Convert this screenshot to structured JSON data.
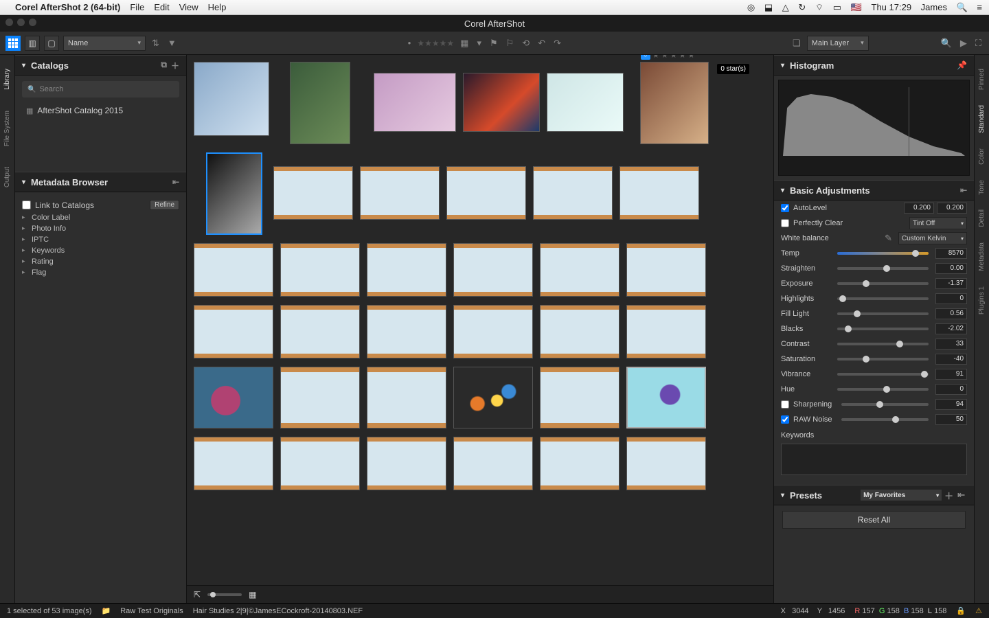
{
  "macbar": {
    "app": "Corel AfterShot 2 (64-bit)",
    "menus": [
      "File",
      "Edit",
      "View",
      "Help"
    ],
    "right": {
      "clock": "Thu 17:29",
      "user": "James"
    }
  },
  "titlebar": {
    "title": "Corel AfterShot"
  },
  "toolbar": {
    "sort_label": "Name",
    "layer_label": "Main Layer"
  },
  "rating_tooltip": "0 star(s)",
  "left_tabs": [
    "Library",
    "File System",
    "Output"
  ],
  "right_tabs": [
    "Pinned",
    "Standard",
    "Color",
    "Tone",
    "Detail",
    "Metadata",
    "Plugins 1"
  ],
  "catalogs": {
    "title": "Catalogs",
    "search_placeholder": "Search",
    "items": [
      "AfterShot Catalog 2015"
    ]
  },
  "metadata_browser": {
    "title": "Metadata Browser",
    "link_label": "Link to Catalogs",
    "refine_label": "Refine",
    "tree": [
      "Color Label",
      "Photo Info",
      "IPTC",
      "Keywords",
      "Rating",
      "Flag"
    ]
  },
  "histogram": {
    "title": "Histogram"
  },
  "basic_adjustments": {
    "title": "Basic Adjustments",
    "autolevel": {
      "label": "AutoLevel",
      "checked": true,
      "v1": "0.200",
      "v2": "0.200"
    },
    "perfectly_clear": {
      "label": "Perfectly Clear",
      "checked": false,
      "dropdown": "Tint Off"
    },
    "white_balance": {
      "label": "White balance",
      "dropdown": "Custom Kelvin"
    },
    "sliders": {
      "temp": {
        "label": "Temp",
        "value": "8570",
        "pos": 82
      },
      "straighten": {
        "label": "Straighten",
        "value": "0.00",
        "pos": 50
      },
      "exposure": {
        "label": "Exposure",
        "value": "-1.37",
        "pos": 28
      },
      "highlights": {
        "label": "Highlights",
        "value": "0",
        "pos": 2
      },
      "fill_light": {
        "label": "Fill Light",
        "value": "0.56",
        "pos": 18
      },
      "blacks": {
        "label": "Blacks",
        "value": "-2.02",
        "pos": 8
      },
      "contrast": {
        "label": "Contrast",
        "value": "33",
        "pos": 65
      },
      "saturation": {
        "label": "Saturation",
        "value": "-40",
        "pos": 28
      },
      "vibrance": {
        "label": "Vibrance",
        "value": "91",
        "pos": 92
      },
      "hue": {
        "label": "Hue",
        "value": "0",
        "pos": 50
      },
      "sharpening": {
        "label": "Sharpening",
        "value": "94",
        "pos": 40,
        "checked": false
      },
      "raw_noise": {
        "label": "RAW Noise",
        "value": "50",
        "pos": 58,
        "checked": true
      }
    },
    "keywords_label": "Keywords"
  },
  "presets": {
    "title": "Presets",
    "dropdown": "My Favorites"
  },
  "reset_label": "Reset All",
  "status": {
    "selection": "1 selected of 53 image(s)",
    "folder": "Raw Test Originals",
    "filename": "Hair Studies 2|9|©JamesECockroft-20140803.NEF",
    "coords": {
      "x_label": "X",
      "x": "3044",
      "y_label": "Y",
      "y": "1456"
    },
    "rgb": {
      "r_label": "R",
      "r": "157",
      "g_label": "G",
      "g": "158",
      "b_label": "B",
      "b": "158",
      "l_label": "L",
      "l": "158"
    }
  }
}
